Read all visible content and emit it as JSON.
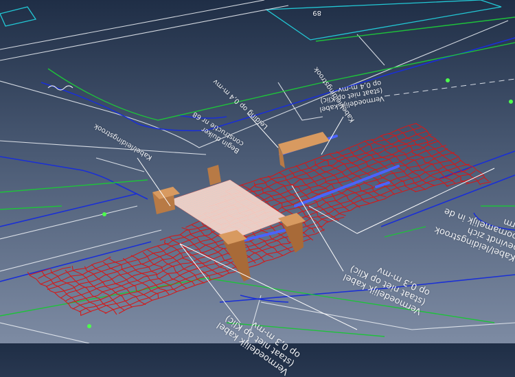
{
  "scene": {
    "colors": {
      "background_top": "#1f2e46",
      "background_bottom": "#7d8ba3",
      "kerb_lines": "#1a2fd6",
      "parcel_lines": "#1ec23a",
      "outline_lines": "#e8ecf2",
      "building_outline": "#22c9d6",
      "cable_mesh": "#d21a1a",
      "detected_cable": "#4a63ff",
      "pit_walls": "#b87a45",
      "markers": "#4cff4c"
    }
  },
  "labels": {
    "house_number": "89",
    "cable_strip_top": "Kabel/leidingstrook",
    "presumed_cable_top": "Vermoedelijk kabel\n(staat niet op Klic)\nop 0,4 m-mv",
    "cable_strip_left": "Kabel/leidingstrook",
    "pipe_depth": "Leiding op 0,4 m-mv",
    "start_duiker": "Begin duiker\nconstructie nr 68",
    "strip_berm": "Kabel/leidingstrook\nbevindt zich\nvoornamelijk in de\nberm",
    "presumed_cable_right": "Vermoedelijk kabel\n(staat niet op Klic)\nop 0,3 m-mv",
    "presumed_cable_bottom": "Vermoedelijk kabel\n(staat niet op Klic)\nop 0,3 m-mv"
  }
}
